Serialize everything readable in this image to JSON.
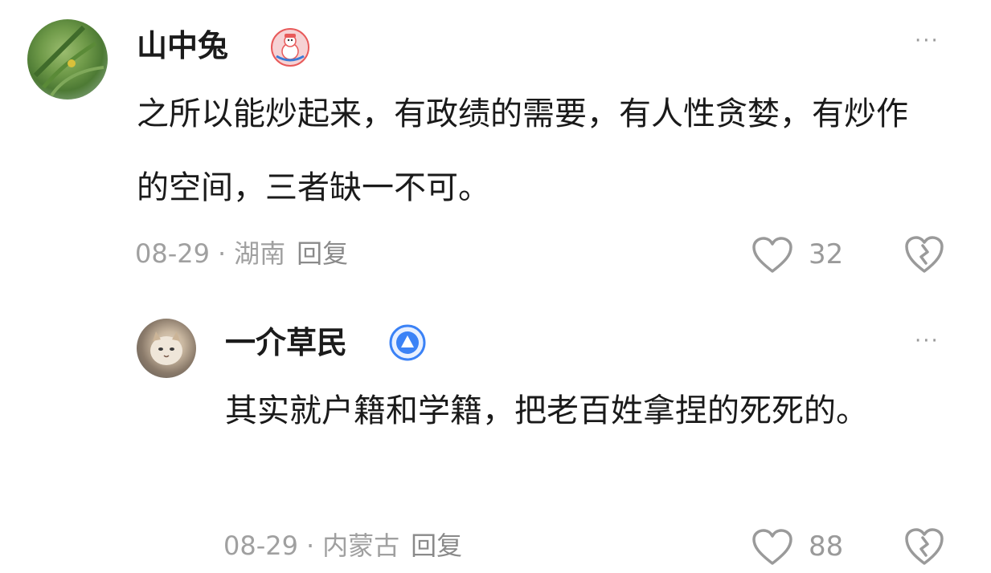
{
  "comment": {
    "author": "山中兔",
    "badge_icon": "snowman-badge-icon",
    "text": "之所以能炒起来，有政绩的需要，有人性贪婪，有炒作的空间，三者缺一不可。",
    "date": "08-29",
    "location": "湖南",
    "reply_label": "回复",
    "like_count": "32",
    "more_label": "···"
  },
  "reply": {
    "author": "一介草民",
    "badge_icon": "blue-triangle-badge-icon",
    "text": "其实就户籍和学籍，把老百姓拿捏的死死的。",
    "date": "08-29",
    "location": "内蒙古",
    "reply_label": "回复",
    "like_count": "88",
    "more_label": "···"
  },
  "colors": {
    "muted": "#a0a0a0",
    "badge_red": "#e85a5a",
    "badge_blue": "#3b82f6"
  }
}
